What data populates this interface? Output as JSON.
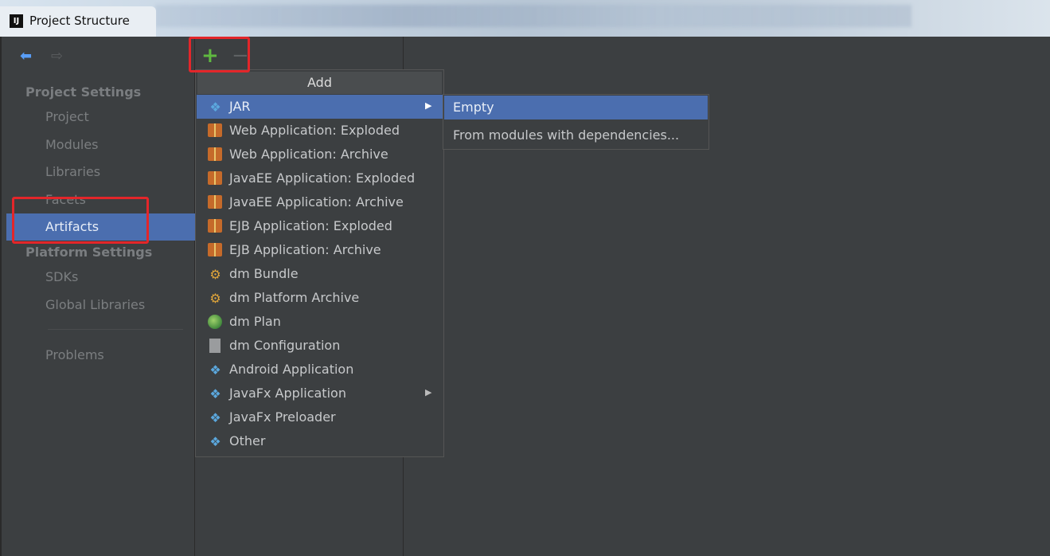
{
  "window": {
    "title": "Project Structure",
    "app_icon": "IJ"
  },
  "nav": {
    "back_icon": "back-arrow-icon",
    "forward_icon": "forward-arrow-icon"
  },
  "sidebar": {
    "project_settings_header": "Project Settings",
    "project_items": [
      "Project",
      "Modules",
      "Libraries",
      "Facets",
      "Artifacts"
    ],
    "selected": "Artifacts",
    "platform_settings_header": "Platform Settings",
    "platform_items": [
      "SDKs",
      "Global Libraries"
    ],
    "problems": "Problems"
  },
  "toolbar": {
    "add": "+",
    "remove": "−"
  },
  "add_menu": {
    "title": "Add",
    "items": [
      {
        "label": "JAR",
        "icon": "jar-icon",
        "submenu": true,
        "selected": true
      },
      {
        "label": "Web Application: Exploded",
        "icon": "web-app-icon"
      },
      {
        "label": "Web Application: Archive",
        "icon": "web-app-icon"
      },
      {
        "label": "JavaEE Application: Exploded",
        "icon": "javaee-app-icon"
      },
      {
        "label": "JavaEE Application: Archive",
        "icon": "javaee-app-icon"
      },
      {
        "label": "EJB Application: Exploded",
        "icon": "ejb-app-icon"
      },
      {
        "label": "EJB Application: Archive",
        "icon": "ejb-app-icon"
      },
      {
        "label": "dm Bundle",
        "icon": "dm-bundle-icon"
      },
      {
        "label": "dm Platform Archive",
        "icon": "dm-platform-icon"
      },
      {
        "label": "dm Plan",
        "icon": "dm-plan-icon"
      },
      {
        "label": "dm Configuration",
        "icon": "dm-configuration-icon"
      },
      {
        "label": "Android Application",
        "icon": "android-app-icon"
      },
      {
        "label": "JavaFx Application",
        "icon": "javafx-app-icon",
        "submenu": true
      },
      {
        "label": "JavaFx Preloader",
        "icon": "javafx-preloader-icon"
      },
      {
        "label": "Other",
        "icon": "other-icon"
      }
    ]
  },
  "jar_submenu": {
    "items": [
      {
        "label": "Empty",
        "selected": true
      },
      {
        "label": "From modules with dependencies..."
      }
    ]
  },
  "colors": {
    "background": "#3c3f41",
    "selection": "#4b6eaf",
    "highlight_box": "#e3262a",
    "add_green": "#5fb840"
  }
}
